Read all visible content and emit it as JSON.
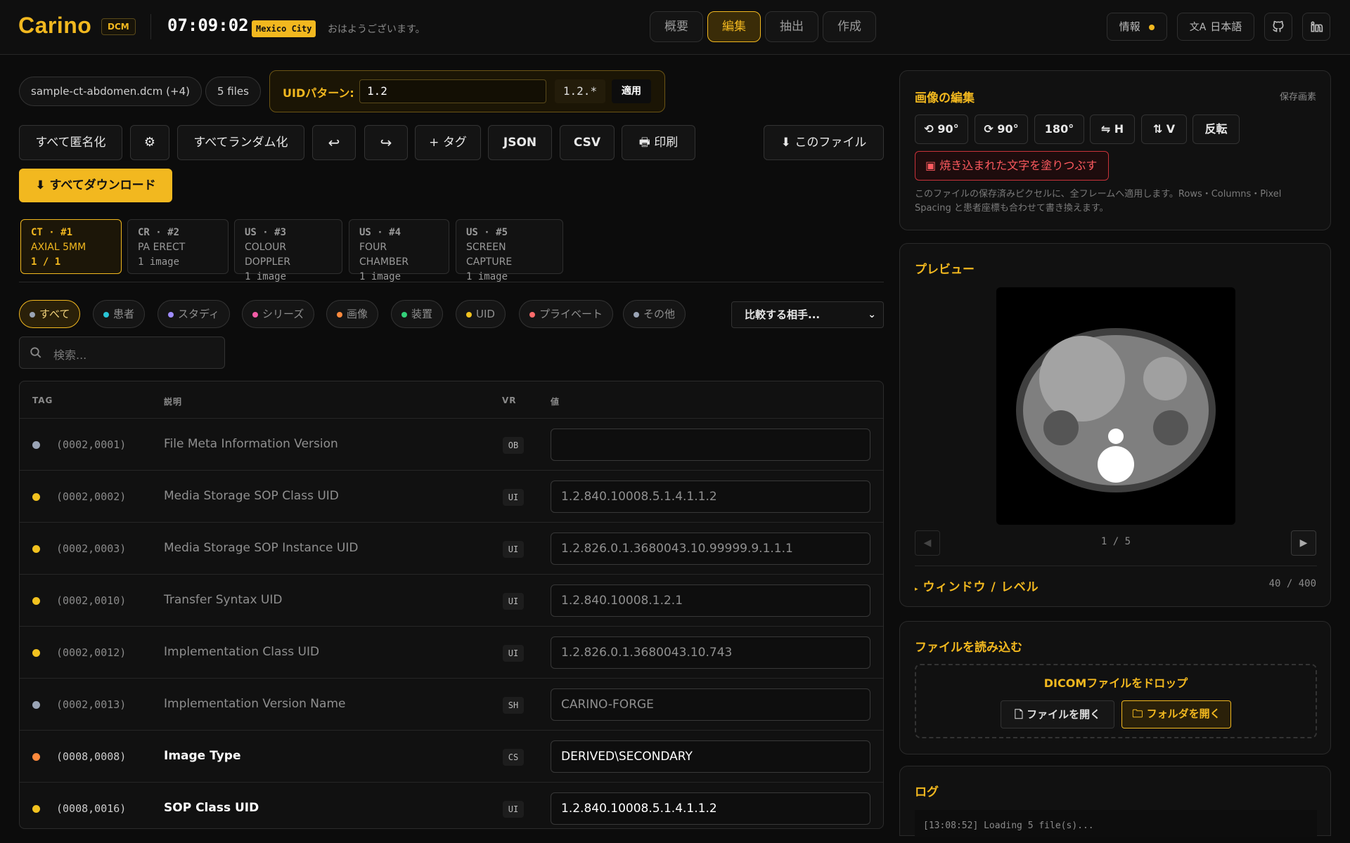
{
  "header": {
    "logo": "Carino",
    "badge": "DCM",
    "clock": "07:09:02",
    "city": "Mexico City",
    "greeting": "おはようございます。",
    "tabs": [
      "概要",
      "編集",
      "抽出",
      "作成"
    ],
    "active_tab": "編集",
    "info_label": "情報",
    "language_label": "日本語",
    "accent_color": "#f2b81f"
  },
  "toolbar": {
    "file_name": "sample-ct-abdomen.dcm (+4)",
    "file_count": "5 files",
    "uid_pattern_label": "UIDパターン:",
    "uid_pattern_value": "1.2",
    "uid_pattern_preview": "1.2.*",
    "apply_label": "適用",
    "anonymize_all": "すべて匿名化",
    "settings_icon": "gear-icon",
    "randomize_all": "すべてランダム化",
    "undo_icon": "undo-icon",
    "redo_icon": "redo-icon",
    "add_tag": "+ タグ",
    "json": "JSON",
    "csv": "CSV",
    "print": "印刷",
    "this_file": "このファイル",
    "download_all": "すべてダウンロード"
  },
  "file_tabs": [
    {
      "modality": "CT · #1",
      "desc": "AXIAL 5MM",
      "count": "1 / 1"
    },
    {
      "modality": "CR · #2",
      "desc": "PA ERECT",
      "count": "1 image"
    },
    {
      "modality": "US · #3",
      "desc": "COLOUR DOPPLER",
      "count": "1 image"
    },
    {
      "modality": "US · #4",
      "desc": "FOUR CHAMBER",
      "count": "1 image"
    },
    {
      "modality": "US · #5",
      "desc": "SCREEN CAPTURE",
      "count": "1 image"
    }
  ],
  "filters": [
    {
      "label": "すべて",
      "color": "#9aa4b5"
    },
    {
      "label": "患者",
      "color": "#29c5d6"
    },
    {
      "label": "スタディ",
      "color": "#9f8cff"
    },
    {
      "label": "シリーズ",
      "color": "#f25ca6"
    },
    {
      "label": "画像",
      "color": "#ff8a3d"
    },
    {
      "label": "装置",
      "color": "#33d17a"
    },
    {
      "label": "UID",
      "color": "#f2c21f"
    },
    {
      "label": "プライベート",
      "color": "#ff6b6b"
    },
    {
      "label": "その他",
      "color": "#9aa4b5"
    }
  ],
  "compare_select": "比較する相手...",
  "search_placeholder": "検索...",
  "table": {
    "headers": [
      "TAG",
      "説明",
      "VR",
      "値"
    ],
    "rows": [
      {
        "tag": "(0002,0001)",
        "desc": "File Meta Information Version",
        "vr": "OB",
        "value": "",
        "color": "#9aa4b5",
        "bright": false
      },
      {
        "tag": "(0002,0002)",
        "desc": "Media Storage SOP Class UID",
        "vr": "UI",
        "value": "1.2.840.10008.5.1.4.1.1.2",
        "color": "#f2c21f",
        "bright": false
      },
      {
        "tag": "(0002,0003)",
        "desc": "Media Storage SOP Instance UID",
        "vr": "UI",
        "value": "1.2.826.0.1.3680043.10.99999.9.1.1.1",
        "color": "#f2c21f",
        "bright": false
      },
      {
        "tag": "(0002,0010)",
        "desc": "Transfer Syntax UID",
        "vr": "UI",
        "value": "1.2.840.10008.1.2.1",
        "color": "#f2c21f",
        "bright": false
      },
      {
        "tag": "(0002,0012)",
        "desc": "Implementation Class UID",
        "vr": "UI",
        "value": "1.2.826.0.1.3680043.10.743",
        "color": "#f2c21f",
        "bright": false
      },
      {
        "tag": "(0002,0013)",
        "desc": "Implementation Version Name",
        "vr": "SH",
        "value": "CARINO-FORGE",
        "color": "#9aa4b5",
        "bright": false
      },
      {
        "tag": "(0008,0008)",
        "desc": "Image Type",
        "vr": "CS",
        "value": "DERIVED\\SECONDARY",
        "color": "#ff8a3d",
        "bright": true
      },
      {
        "tag": "(0008,0016)",
        "desc": "SOP Class UID",
        "vr": "UI",
        "value": "1.2.840.10008.5.1.4.1.1.2",
        "color": "#f2c21f",
        "bright": true
      }
    ]
  },
  "image_edit": {
    "title": "画像の編集",
    "save_pixels": "保存画素",
    "buttons": [
      "⟲ 90°",
      "⟳ 90°",
      "180°",
      "⇋ H",
      "⇅ V",
      "反転"
    ],
    "burn_in": "焼き込まれた文字を塗りつぶす",
    "note": "このファイルの保存済みピクセルに、全フレームへ適用します。Rows・Columns・Pixel Spacing と患者座標も合わせて書き換えます。"
  },
  "preview": {
    "title": "プレビュー",
    "page": "1 / 5",
    "window_level_label": "ウィンドウ / レベル",
    "window_level_value": "40 / 400"
  },
  "load": {
    "title": "ファイルを読み込む",
    "drop": "DICOMファイルをドロップ",
    "open_file": "ファイルを開く",
    "open_folder": "フォルダを開く"
  },
  "log": {
    "title": "ログ",
    "line": "[13:08:52] Loading 5 file(s)..."
  }
}
